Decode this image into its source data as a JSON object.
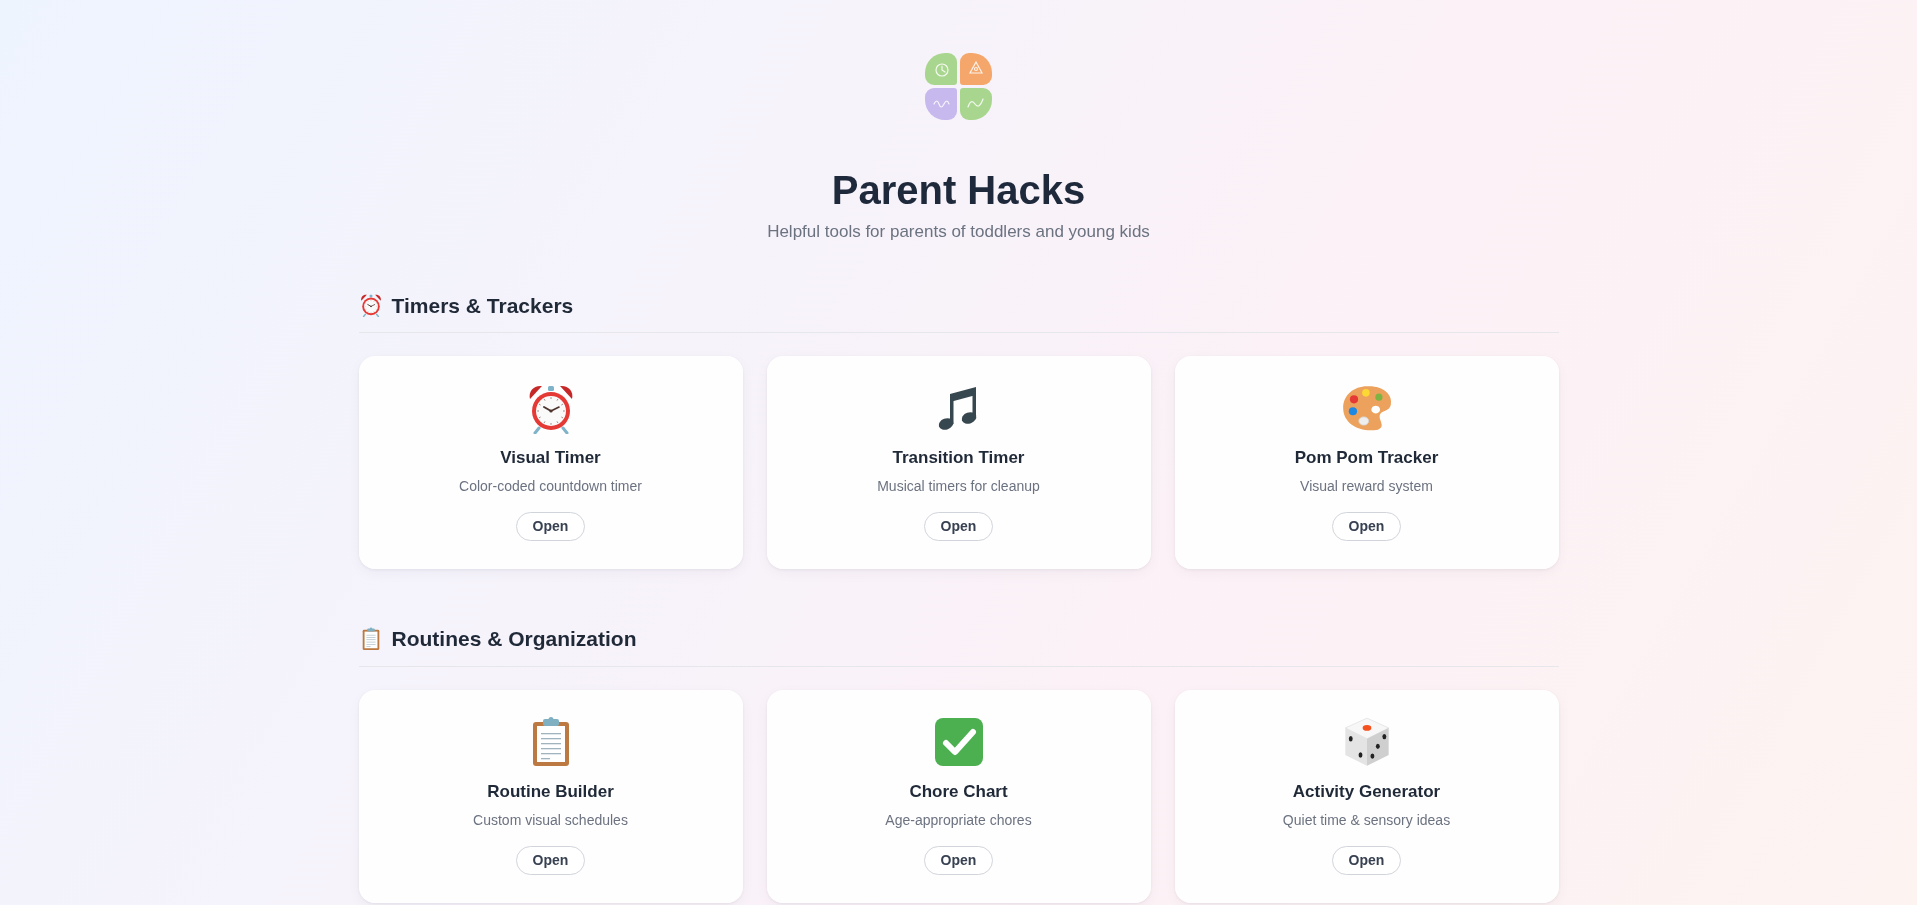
{
  "header": {
    "title": "Parent Hacks",
    "subtitle": "Helpful tools for parents of toddlers and young kids"
  },
  "sections": [
    {
      "kind": "clock",
      "title": "Timers & Trackers",
      "cards": [
        {
          "kind": "clock",
          "title": "Visual Timer",
          "description": "Color-coded countdown timer",
          "button": "Open"
        },
        {
          "kind": "note",
          "title": "Transition Timer",
          "description": "Musical timers for cleanup",
          "button": "Open"
        },
        {
          "kind": "palette",
          "title": "Pom Pom Tracker",
          "description": "Visual reward system",
          "button": "Open"
        }
      ]
    },
    {
      "kind": "clipboard",
      "title": "Routines & Organization",
      "cards": [
        {
          "kind": "clipboard",
          "title": "Routine Builder",
          "description": "Custom visual schedules",
          "button": "Open"
        },
        {
          "kind": "check",
          "title": "Chore Chart",
          "description": "Age-appropriate chores",
          "button": "Open"
        },
        {
          "kind": "die",
          "title": "Activity Generator",
          "description": "Quiet time & sensory ideas",
          "button": "Open"
        }
      ]
    }
  ]
}
